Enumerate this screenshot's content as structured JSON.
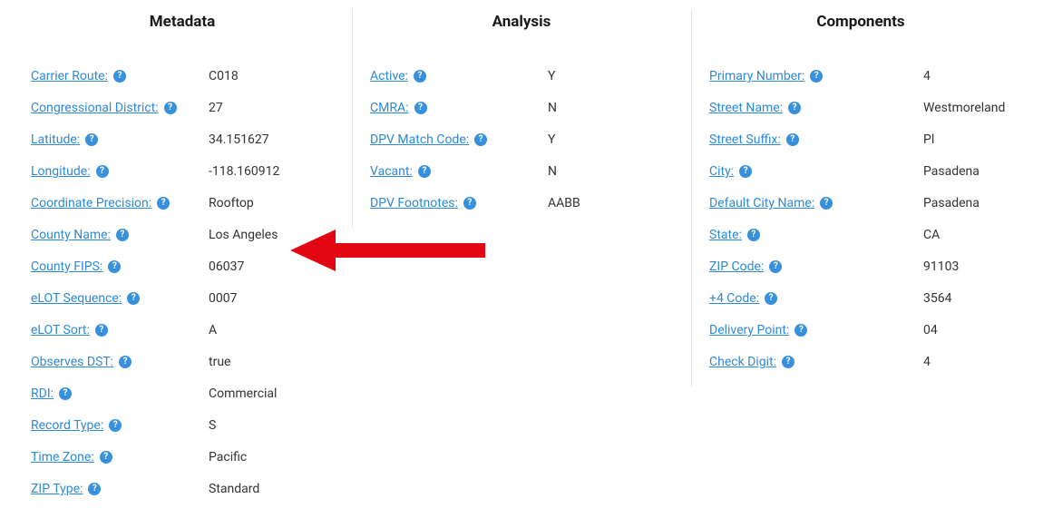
{
  "columns": {
    "metadata": {
      "title": "Metadata",
      "rows": [
        {
          "label": "Carrier Route:",
          "value": "C018"
        },
        {
          "label": "Congressional District:",
          "value": "27"
        },
        {
          "label": "Latitude:",
          "value": "34.151627"
        },
        {
          "label": "Longitude:",
          "value": "-118.160912"
        },
        {
          "label": "Coordinate Precision:",
          "value": "Rooftop"
        },
        {
          "label": "County Name:",
          "value": "Los Angeles"
        },
        {
          "label": "County FIPS:",
          "value": "06037"
        },
        {
          "label": "eLOT Sequence:",
          "value": "0007"
        },
        {
          "label": "eLOT Sort:",
          "value": "A"
        },
        {
          "label": "Observes DST:",
          "value": "true"
        },
        {
          "label": "RDI:",
          "value": "Commercial"
        },
        {
          "label": "Record Type:",
          "value": "S"
        },
        {
          "label": "Time Zone:",
          "value": "Pacific"
        },
        {
          "label": "ZIP Type:",
          "value": "Standard"
        }
      ]
    },
    "analysis": {
      "title": "Analysis",
      "rows": [
        {
          "label": "Active:",
          "value": "Y"
        },
        {
          "label": "CMRA:",
          "value": "N"
        },
        {
          "label": "DPV Match Code:",
          "value": "Y"
        },
        {
          "label": "Vacant:",
          "value": "N"
        },
        {
          "label": "DPV Footnotes:",
          "value": "AABB"
        }
      ]
    },
    "components": {
      "title": "Components",
      "rows": [
        {
          "label": "Primary Number:",
          "value": "4"
        },
        {
          "label": "Street Name:",
          "value": "Westmoreland"
        },
        {
          "label": "Street Suffix:",
          "value": "Pl"
        },
        {
          "label": "City:",
          "value": "Pasadena"
        },
        {
          "label": "Default City Name:",
          "value": "Pasadena"
        },
        {
          "label": "State:",
          "value": "CA"
        },
        {
          "label": "ZIP Code:",
          "value": "91103"
        },
        {
          "label": "+4 Code:",
          "value": "3564"
        },
        {
          "label": "Delivery Point:",
          "value": "04"
        },
        {
          "label": "Check Digit:",
          "value": "4"
        }
      ]
    }
  },
  "annotation": {
    "type": "arrow",
    "color": "#e30613",
    "points_to": "columns.metadata.rows.5.value"
  }
}
